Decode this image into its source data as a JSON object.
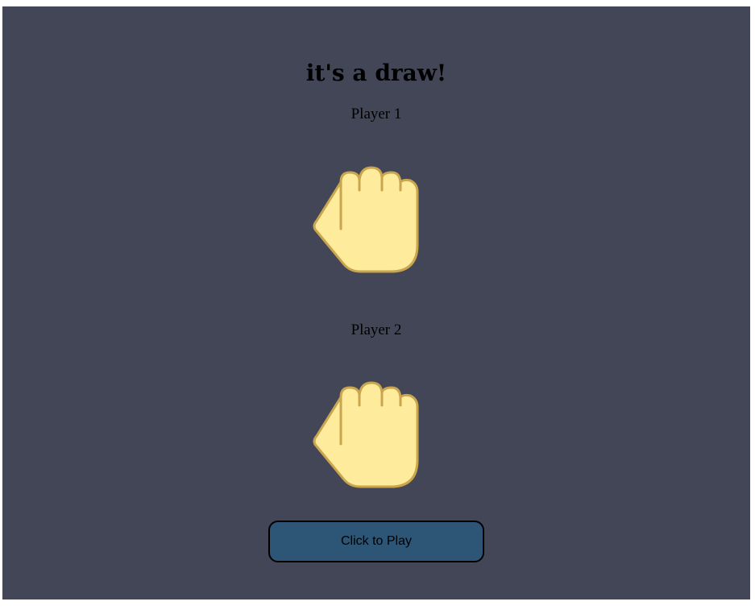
{
  "result": {
    "title": "it's a draw!"
  },
  "player1": {
    "label": "Player 1",
    "choice_icon": "rock-fist-icon"
  },
  "player2": {
    "label": "Player 2",
    "choice_icon": "rock-fist-icon"
  },
  "play_button": {
    "label": "Click to Play"
  },
  "colors": {
    "page_background": "#424656",
    "hand_fill": "#ffeb9c",
    "hand_outline": "#c9a54e",
    "button_fill": "#2d5576"
  }
}
